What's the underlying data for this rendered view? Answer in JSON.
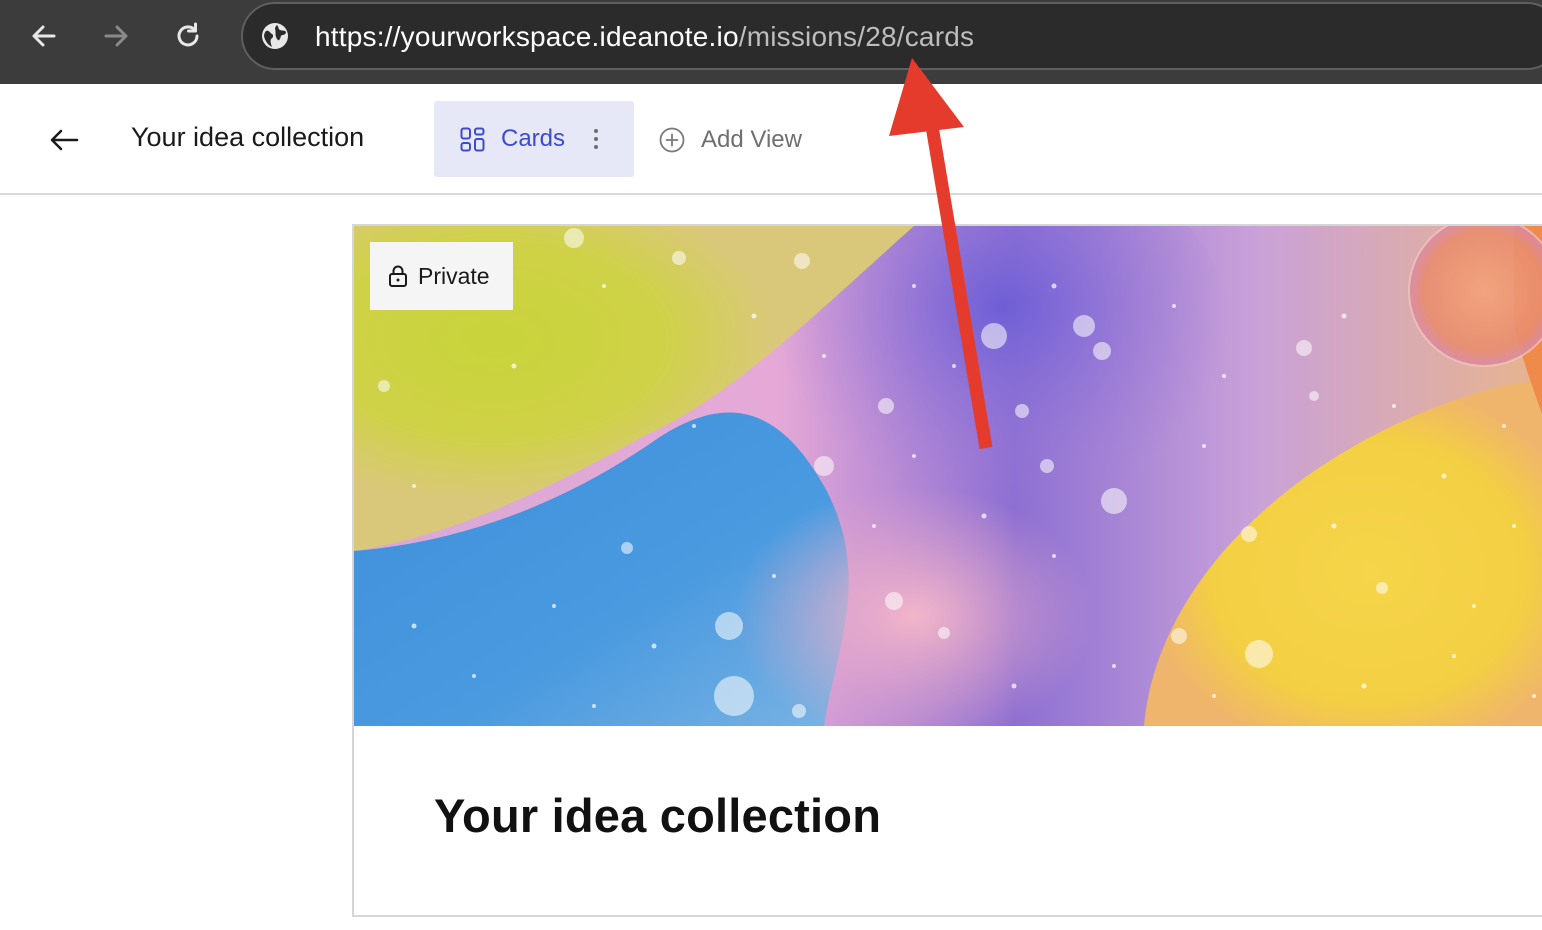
{
  "browser": {
    "url_host": "https://yourworkspace.ideanote.io",
    "url_path": "/missions/28/cards",
    "nav": {
      "back_icon": "arrow-left-icon",
      "forward_icon": "arrow-right-icon",
      "reload_icon": "reload-icon",
      "site_icon": "globe-icon"
    }
  },
  "header": {
    "back_icon": "arrow-left-icon",
    "title": "Your idea collection",
    "active_view": {
      "label": "Cards",
      "icon": "grid-icon",
      "menu_icon": "vertical-dots-icon"
    },
    "add_view": {
      "label": "Add View",
      "icon": "plus-circle-icon"
    }
  },
  "card": {
    "badge": {
      "label": "Private",
      "icon": "lock-icon"
    },
    "title": "Your idea collection"
  },
  "colors": {
    "browser_chrome": "#3c3c3c",
    "active_tab_bg": "#e6e8f8",
    "active_tab_text": "#3d4bcf",
    "annotation_arrow": "#e53b2c"
  }
}
